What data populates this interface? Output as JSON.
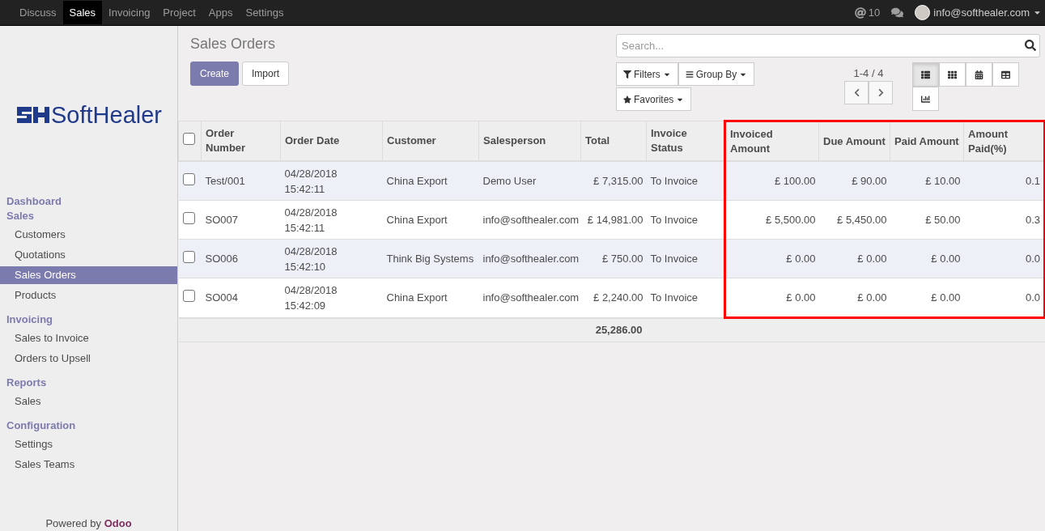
{
  "topbar": {
    "apps": [
      {
        "label": "Discuss",
        "selected": false
      },
      {
        "label": "Sales",
        "selected": true
      },
      {
        "label": "Invoicing",
        "selected": false
      },
      {
        "label": "Project",
        "selected": false
      },
      {
        "label": "Apps",
        "selected": false
      },
      {
        "label": "Settings",
        "selected": false
      }
    ],
    "mention_count": "10",
    "user": "info@softhealer.com"
  },
  "sidebar": {
    "logo": "SoftHealer",
    "sections": [
      {
        "title": "Dashboard"
      },
      {
        "title": "Sales",
        "items": [
          {
            "label": "Customers",
            "selected": false
          },
          {
            "label": "Quotations",
            "selected": false
          },
          {
            "label": "Sales Orders",
            "selected": true
          },
          {
            "label": "Products",
            "selected": false
          }
        ]
      },
      {
        "title": "Invoicing",
        "items": [
          {
            "label": "Sales to Invoice",
            "selected": false
          },
          {
            "label": "Orders to Upsell",
            "selected": false
          }
        ]
      },
      {
        "title": "Reports",
        "items": [
          {
            "label": "Sales",
            "selected": false
          }
        ]
      },
      {
        "title": "Configuration",
        "items": [
          {
            "label": "Settings",
            "selected": false
          },
          {
            "label": "Sales Teams",
            "selected": false
          }
        ]
      }
    ],
    "powered_by": "Powered by",
    "brand": "Odoo"
  },
  "main": {
    "title": "Sales Orders",
    "buttons": [
      {
        "label": "Create",
        "kind": "primary"
      },
      {
        "label": "Import",
        "kind": "secondary"
      }
    ],
    "search": {
      "placeholder": "Search..."
    },
    "filters": [
      {
        "label": "Filters",
        "kind": "filter"
      },
      {
        "label": "Group By",
        "kind": "group"
      },
      {
        "label": "Favorites",
        "kind": "star"
      }
    ],
    "pager": "1-4 / 4",
    "views": [
      {
        "kind": "list",
        "selected": true
      },
      {
        "kind": "kanban",
        "selected": false
      },
      {
        "kind": "calendar",
        "selected": false
      },
      {
        "kind": "pivot",
        "selected": false
      },
      {
        "kind": "graph",
        "selected": false
      }
    ]
  },
  "table": {
    "select_all_checked": false,
    "columns": [
      {
        "label": "Order Number",
        "highlighted": false
      },
      {
        "label": "Order Date",
        "highlighted": false
      },
      {
        "label": "Customer",
        "highlighted": false
      },
      {
        "label": "Salesperson",
        "highlighted": false
      },
      {
        "label": "Total",
        "highlighted": false
      },
      {
        "label": "Invoice Status",
        "highlighted": false
      },
      {
        "label": "Invoiced Amount",
        "highlighted": true
      },
      {
        "label": "Due Amount",
        "highlighted": true
      },
      {
        "label": "Paid Amount",
        "highlighted": true
      },
      {
        "label": "Amount Paid(%)",
        "highlighted": true
      }
    ],
    "rows": [
      {
        "checked": false,
        "cells": [
          "Test/001",
          "04/28/2018 15:42:11",
          "China Export",
          "Demo User",
          "£ 7,315.00",
          "To Invoice",
          "£ 100.00",
          "£ 90.00",
          "£ 10.00",
          "0.1"
        ]
      },
      {
        "checked": false,
        "cells": [
          "SO007",
          "04/28/2018 15:42:11",
          "China Export",
          "info@softhealer.com",
          "£ 14,981.00",
          "To Invoice",
          "£ 5,500.00",
          "£ 5,450.00",
          "£ 50.00",
          "0.3"
        ]
      },
      {
        "checked": false,
        "cells": [
          "SO006",
          "04/28/2018 15:42:10",
          "Think Big Systems",
          "info@softhealer.com",
          "£ 750.00",
          "To Invoice",
          "£ 0.00",
          "£ 0.00",
          "£ 0.00",
          "0.0"
        ]
      },
      {
        "checked": false,
        "cells": [
          "SO004",
          "04/28/2018 15:42:09",
          "China Export",
          "info@softhealer.com",
          "£ 2,240.00",
          "To Invoice",
          "£ 0.00",
          "£ 0.00",
          "£ 0.00",
          "0.0"
        ]
      }
    ],
    "total": "25,286.00"
  }
}
